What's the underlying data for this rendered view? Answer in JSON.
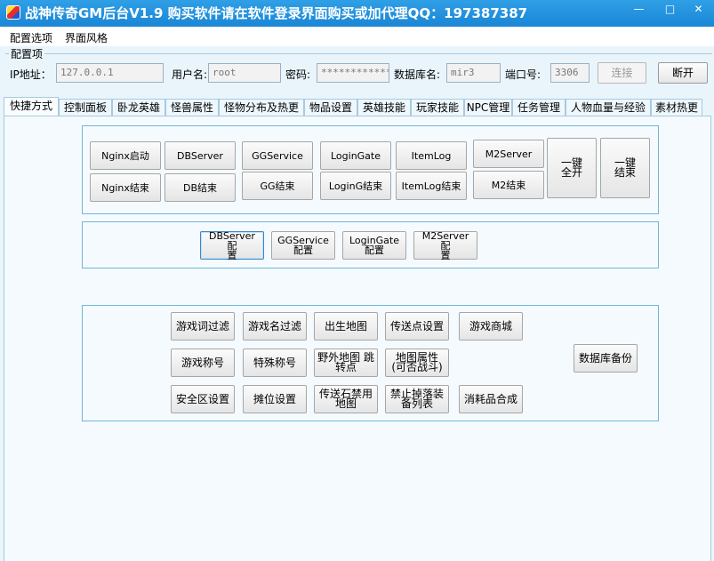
{
  "window": {
    "title": "战神传奇GM后台V1.9   购买软件请在软件登录界面购买或加代理QQ：197387387",
    "controls": [
      "—",
      "□",
      "✕"
    ]
  },
  "menu": [
    "配置选项",
    "界面风格"
  ],
  "config": {
    "legend": "配置项",
    "ip_label": "IP地址：",
    "ip_value": "127.0.0.1",
    "user_label": "用户名:",
    "user_value": "root",
    "pass_label": "密码:",
    "pass_value": "************",
    "db_label": "数据库名:",
    "db_value": "mir3",
    "port_label": "端口号:",
    "port_value": "3306",
    "connect_label": "连接",
    "disconnect_label": "断开"
  },
  "tabs": [
    "快捷方式",
    "控制面板",
    "卧龙英雄",
    "怪兽属性",
    "怪物分布及热更",
    "物品设置",
    "英雄技能",
    "玩家技能",
    "NPC管理",
    "任务管理",
    "人物血量与经验",
    "素材热更"
  ],
  "server_buttons": [
    "Nginx启动",
    "DBServer",
    "GGService",
    "LoginGate",
    "ItemLog",
    "M2Server",
    "Nginx结束",
    "DB结束",
    "GG结束",
    "LoginG结束",
    "ItemLog结束",
    "M2结束",
    "一键\n全开",
    "一键\n结束"
  ],
  "config_buttons": [
    "DBServer 配\n置",
    "GGService\n配置",
    "LoginGate\n配置",
    "M2Server 配\n置"
  ],
  "tool_buttons": [
    "游戏词过滤",
    "游戏名过滤",
    "出生地图",
    "传送点设置",
    "游戏商城",
    "游戏称号",
    "特殊称号",
    "野外地图 跳\n转点",
    "地图属性\n(可否战斗)",
    "安全区设置",
    "摊位设置",
    "传送石禁用\n地图",
    "禁止掉落装\n备列表",
    "消耗品合成",
    "数据库备份"
  ]
}
